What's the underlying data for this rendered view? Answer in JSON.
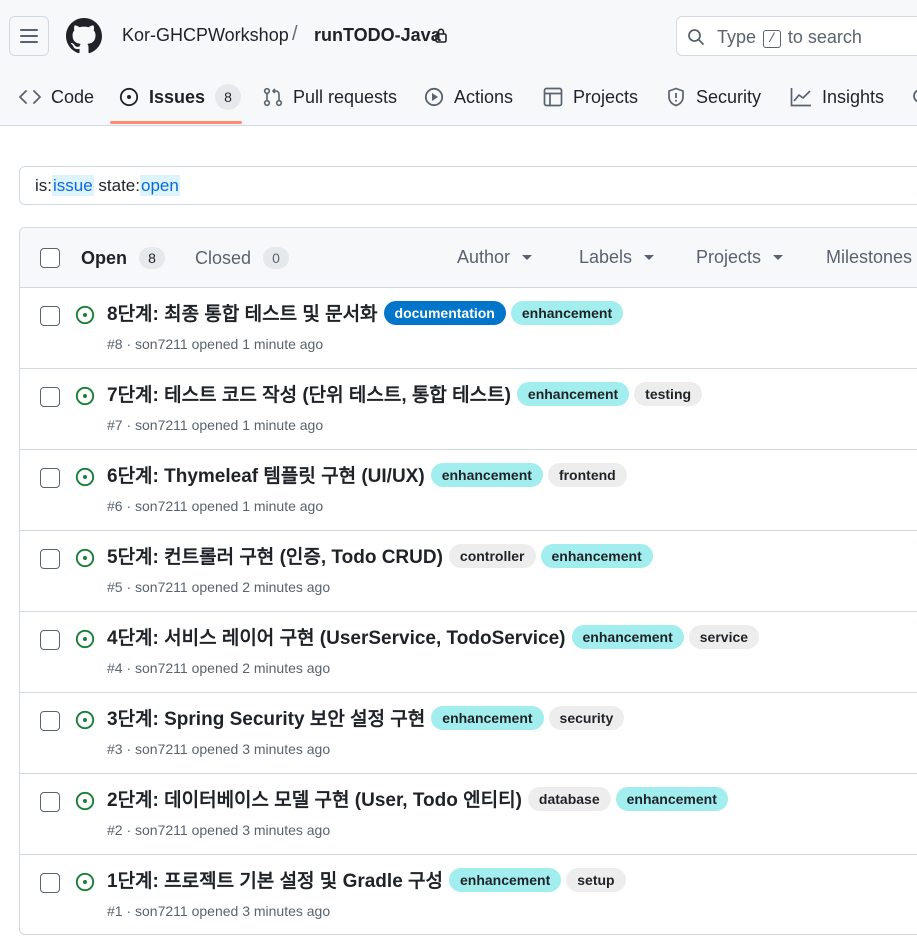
{
  "header": {
    "owner": "Kor-GHCPWorkshop",
    "separator": "/",
    "repo": "runTODO-Java",
    "search_prefix": "Type",
    "search_key": "/",
    "search_suffix": "to search"
  },
  "nav": {
    "code": "Code",
    "issues": "Issues",
    "issues_count": "8",
    "pulls": "Pull requests",
    "actions": "Actions",
    "projects": "Projects",
    "security": "Security",
    "insights": "Insights"
  },
  "filter": {
    "k1": "is:",
    "v1": "issue",
    "k2": " state:",
    "v2": "open"
  },
  "list_header": {
    "open_label": "Open",
    "open_count": "8",
    "closed_label": "Closed",
    "closed_count": "0",
    "author": "Author",
    "labels": "Labels",
    "projects": "Projects",
    "milestones": "Milestones"
  },
  "colors": {
    "open_icon": "#1a7f37",
    "label_documentation": "#0075ca",
    "label_enhancement": "#a2eeef",
    "label_neutral": "#ededed",
    "tab_underline": "#fd8c73"
  },
  "issues": [
    {
      "title": "8단계: 최종 통합 테스트 및 문서화",
      "labels": [
        {
          "name": "documentation",
          "bg": "#0075ca",
          "fg": "#ffffff"
        },
        {
          "name": "enhancement",
          "bg": "#a2eeef",
          "fg": "#1f2328"
        }
      ],
      "meta": "#8 · son7211 opened 1 minute ago"
    },
    {
      "title": "7단계: 테스트 코드 작성 (단위 테스트, 통합 테스트)",
      "labels": [
        {
          "name": "enhancement",
          "bg": "#a2eeef",
          "fg": "#1f2328"
        },
        {
          "name": "testing",
          "bg": "#ededed",
          "fg": "#1f2328"
        }
      ],
      "meta": "#7 · son7211 opened 1 minute ago"
    },
    {
      "title": "6단계: Thymeleaf 템플릿 구현 (UI/UX)",
      "labels": [
        {
          "name": "enhancement",
          "bg": "#a2eeef",
          "fg": "#1f2328"
        },
        {
          "name": "frontend",
          "bg": "#ededed",
          "fg": "#1f2328"
        }
      ],
      "meta": "#6 · son7211 opened 1 minute ago"
    },
    {
      "title": "5단계: 컨트롤러 구현 (인증, Todo CRUD)",
      "labels": [
        {
          "name": "controller",
          "bg": "#ededed",
          "fg": "#1f2328"
        },
        {
          "name": "enhancement",
          "bg": "#a2eeef",
          "fg": "#1f2328"
        }
      ],
      "meta": "#5 · son7211 opened 2 minutes ago"
    },
    {
      "title": "4단계: 서비스 레이어 구현 (UserService, TodoService)",
      "labels": [
        {
          "name": "enhancement",
          "bg": "#a2eeef",
          "fg": "#1f2328"
        },
        {
          "name": "service",
          "bg": "#ededed",
          "fg": "#1f2328"
        }
      ],
      "meta": "#4 · son7211 opened 2 minutes ago"
    },
    {
      "title": "3단계: Spring Security 보안 설정 구현",
      "labels": [
        {
          "name": "enhancement",
          "bg": "#a2eeef",
          "fg": "#1f2328"
        },
        {
          "name": "security",
          "bg": "#ededed",
          "fg": "#1f2328"
        }
      ],
      "meta": "#3 · son7211 opened 3 minutes ago"
    },
    {
      "title": "2단계: 데이터베이스 모델 구현 (User, Todo 엔티티)",
      "labels": [
        {
          "name": "database",
          "bg": "#ededed",
          "fg": "#1f2328"
        },
        {
          "name": "enhancement",
          "bg": "#a2eeef",
          "fg": "#1f2328"
        }
      ],
      "meta": "#2 · son7211 opened 3 minutes ago"
    },
    {
      "title": "1단계: 프로젝트 기본 설정 및 Gradle 구성",
      "labels": [
        {
          "name": "enhancement",
          "bg": "#a2eeef",
          "fg": "#1f2328"
        },
        {
          "name": "setup",
          "bg": "#ededed",
          "fg": "#1f2328"
        }
      ],
      "meta": "#1 · son7211 opened 3 minutes ago"
    }
  ]
}
